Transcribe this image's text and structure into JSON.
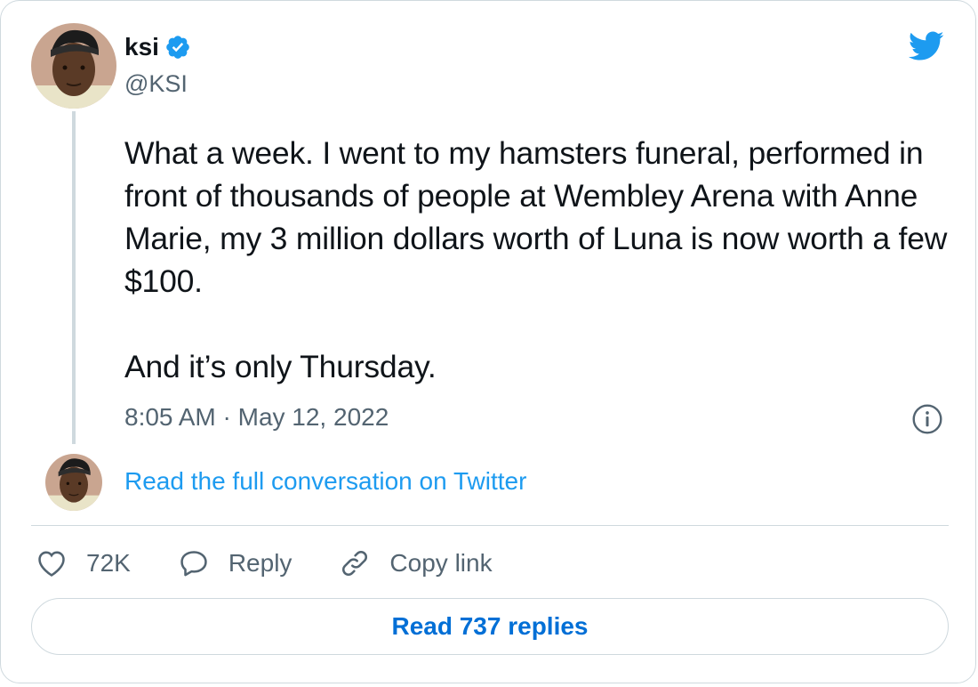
{
  "tweet": {
    "author": {
      "display_name": "ksi",
      "handle": "@KSI",
      "verified": true
    },
    "text": "What a week. I went to my hamsters funeral, performed in front of thousands of people at Wembley Arena with Anne Marie, my 3 million dollars worth of Luna is now worth a few $100.\n\nAnd it’s only Thursday.",
    "timestamp": "8:05 AM · May 12, 2022"
  },
  "conversation": {
    "link_label": "Read the full conversation on Twitter"
  },
  "actions": {
    "likes_count": "72K",
    "reply_label": "Reply",
    "copy_link_label": "Copy link"
  },
  "footer": {
    "read_replies_label": "Read 737 replies"
  },
  "colors": {
    "twitter_blue": "#1d9bf0",
    "link_blue": "#006fd6",
    "text_primary": "#0f1419",
    "text_secondary": "#536471",
    "border": "#cfd9de"
  },
  "icons": {
    "brand": "twitter-bird-icon",
    "verified": "verified-badge-icon",
    "info": "info-icon",
    "like": "heart-icon",
    "reply": "speech-bubble-icon",
    "copy_link": "link-icon"
  }
}
